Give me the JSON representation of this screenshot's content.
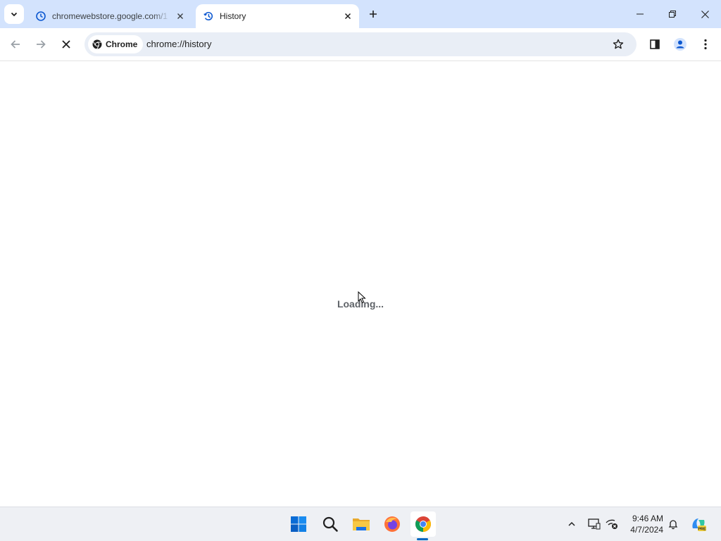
{
  "tabs": [
    {
      "title": "chromewebstore.google.com/1",
      "active": false,
      "favicon": "history-icon"
    },
    {
      "title": "History",
      "active": true,
      "favicon": "history-icon"
    }
  ],
  "omnibox": {
    "site_chip": "Chrome",
    "url": "chrome://history"
  },
  "content": {
    "status_text": "Loading..."
  },
  "taskbar": {
    "apps": [
      "windows-start-icon",
      "search-icon",
      "file-explorer-icon",
      "firefox-icon",
      "chrome-icon"
    ],
    "clock": {
      "time": "9:46 AM",
      "date": "4/7/2024"
    }
  },
  "colors": {
    "tabstrip_bg": "#d3e3fd",
    "omnibox_bg": "#e9eef6",
    "accent": "#0b57d0",
    "taskbar_bg": "#eef0f4"
  }
}
